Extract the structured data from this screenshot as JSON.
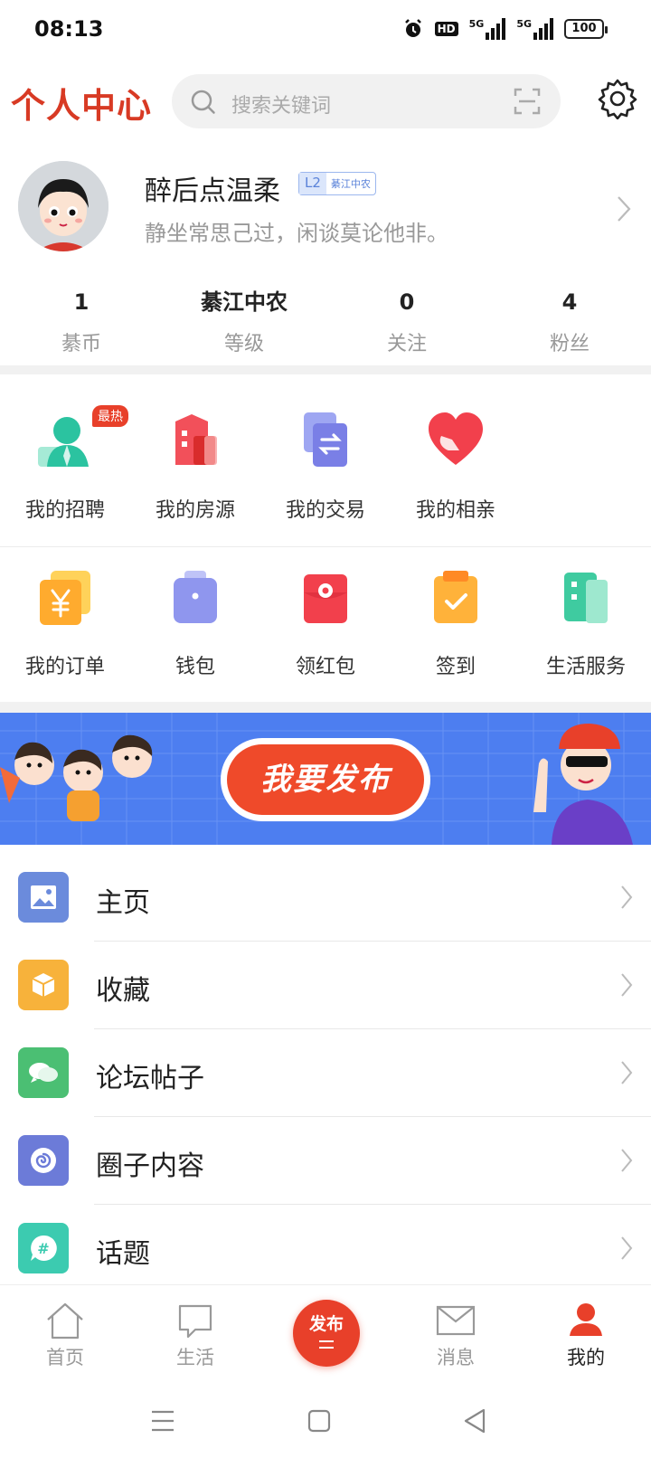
{
  "status_bar": {
    "time": "08:13",
    "hd": "HD",
    "net1": "5G",
    "net2": "5G",
    "battery": "100"
  },
  "header": {
    "title": "个人中心",
    "search_placeholder": "搜索关键词"
  },
  "profile": {
    "name": "醉后点温柔",
    "level": "L2",
    "level_tag": "綦江中农",
    "bio": "静坐常思己过，闲谈莫论他非。"
  },
  "stats": [
    {
      "value": "1",
      "label": "綦币"
    },
    {
      "value": "綦江中农",
      "label": "等级"
    },
    {
      "value": "0",
      "label": "关注"
    },
    {
      "value": "4",
      "label": "粉丝"
    }
  ],
  "services_row1": [
    {
      "label": "我的招聘",
      "badge": "最热",
      "icon": "person-icon"
    },
    {
      "label": "我的房源",
      "icon": "building-icon"
    },
    {
      "label": "我的交易",
      "icon": "exchange-icon"
    },
    {
      "label": "我的相亲",
      "icon": "heart-icon"
    }
  ],
  "services_row2": [
    {
      "label": "我的订单",
      "icon": "yen-icon"
    },
    {
      "label": "钱包",
      "icon": "wallet-icon"
    },
    {
      "label": "领红包",
      "icon": "red-envelope-icon"
    },
    {
      "label": "签到",
      "icon": "checkin-icon"
    },
    {
      "label": "生活服务",
      "icon": "life-service-icon"
    }
  ],
  "banner": {
    "button": "我要发布"
  },
  "menu": [
    {
      "label": "主页",
      "icon": "image-icon",
      "color": "#6b8bdc"
    },
    {
      "label": "收藏",
      "icon": "box-icon",
      "color": "#f7b23b"
    },
    {
      "label": "论坛帖子",
      "icon": "chat-icon",
      "color": "#4bbf73"
    },
    {
      "label": "圈子内容",
      "icon": "circle-icon",
      "color": "#6c7bd8"
    },
    {
      "label": "话题",
      "icon": "hashtag-icon",
      "color": "#3ccbb0"
    }
  ],
  "tabbar": {
    "home": "首页",
    "life": "生活",
    "publish": "发布",
    "messages": "消息",
    "mine": "我的"
  },
  "colors": {
    "brand": "#d83a24",
    "accent": "#e8402a"
  }
}
